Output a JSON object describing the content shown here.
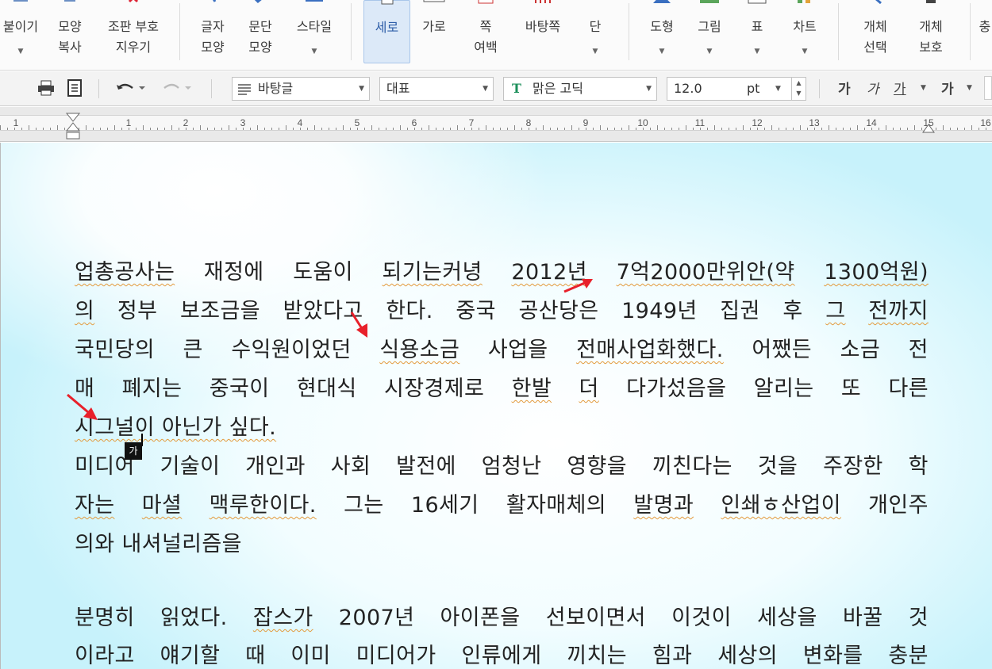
{
  "ribbon": {
    "paste": {
      "line1": "붙이기"
    },
    "copy_format": {
      "line1": "모양",
      "line2": "복사"
    },
    "clear_layout": {
      "line1": "조판 부호",
      "line2": "지우기"
    },
    "char_shape": {
      "line1": "글자",
      "line2": "모양"
    },
    "para_shape": {
      "line1": "문단",
      "line2": "모양"
    },
    "style": {
      "line1": "스타일"
    },
    "portrait": {
      "line1": "세로"
    },
    "landscape": {
      "line1": "가로"
    },
    "margins": {
      "line1": "쪽",
      "line2": "여백"
    },
    "background": {
      "line1": "바탕쪽"
    },
    "columns": {
      "line1": "단"
    },
    "shape": {
      "line1": "도형"
    },
    "picture": {
      "line1": "그림"
    },
    "table": {
      "line1": "표"
    },
    "chart": {
      "line1": "차트"
    },
    "select_object": {
      "line1": "개체",
      "line2": "선택"
    },
    "protect_object": {
      "line1": "개체",
      "line2": "보호"
    },
    "cut_edge": {
      "line1": "충"
    }
  },
  "toolbar": {
    "style_value": "바탕글",
    "lang_value": "대표",
    "font_value": "맑은 고딕",
    "size_value": "12.0",
    "size_unit": "pt",
    "bold": "가",
    "italic": "가",
    "underline": "가",
    "strike": "가"
  },
  "ruler": {
    "numbers": [
      "1",
      "1",
      "2",
      "3",
      "4",
      "5",
      "6",
      "7",
      "8",
      "9",
      "10",
      "11",
      "12",
      "13",
      "14",
      "15",
      "16"
    ]
  },
  "document": {
    "l1": [
      "업총공사는",
      "재정에",
      "도움이",
      "되기는커녕",
      "2012년",
      "7억2000만위안(약",
      "1300억원)"
    ],
    "l2": [
      "의",
      "정부",
      "보조금을",
      "받았다고",
      "한다.",
      "중국",
      "공산당은",
      "1949년",
      "집권",
      "후",
      "그",
      "전까지"
    ],
    "l3": [
      "국민당의",
      "큰",
      "수익원이었던",
      "식용소금",
      "사업을",
      "전매사업화했다.",
      "어쨌든",
      "소금",
      "전"
    ],
    "l4": [
      "매",
      "폐지는",
      "중국이",
      "현대식",
      "시장경제로",
      "한발",
      "더",
      "다가섰음을",
      "알리는",
      "또",
      "다른"
    ],
    "l5": "시그널이 아닌가 싶다.",
    "l6": [
      "미디어",
      "기술이",
      "개인과",
      "사회",
      "발전에",
      "엄청난",
      "영향을",
      "끼친다는",
      "것을",
      "주장한",
      "학"
    ],
    "l7": [
      "자는",
      "마셜",
      "맥루한이다.",
      "그는",
      "16세기",
      "활자매체의",
      "발명과",
      "인쇄ㅎ산업이",
      "개인주"
    ],
    "l8": "의와 내셔널리즘을",
    "l9": [
      "분명히",
      "읽었다.",
      "잡스가",
      "2007년",
      "아이폰을",
      "선보이면서",
      "이것이",
      "세상을",
      "바꿀",
      "것"
    ],
    "l10": [
      "이라고",
      "얘기할",
      "때",
      "이미",
      "미디어가",
      "인류에게",
      "끼치는",
      "힘과",
      "세상의",
      "변화를",
      "충분"
    ],
    "cursor_tip": "가"
  },
  "colors": {
    "accent_active": "#dce9f8",
    "squiggle": "#e39a3c",
    "annotation_arrow": "#e8202a"
  }
}
